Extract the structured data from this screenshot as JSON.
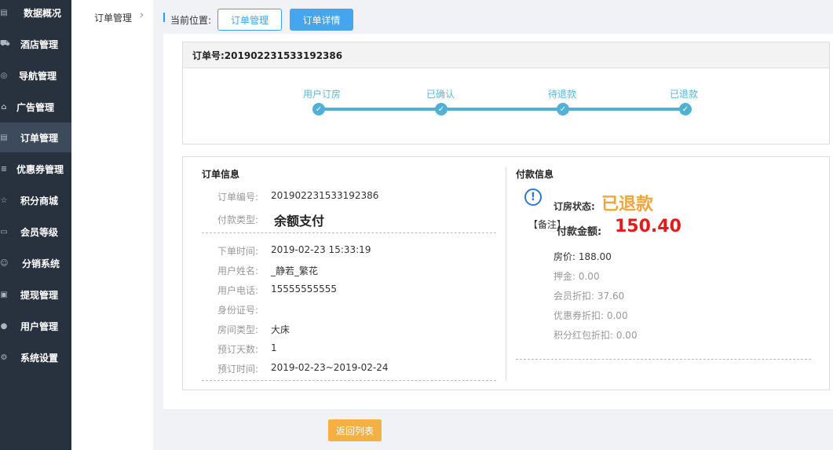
{
  "sidebar": {
    "items": [
      {
        "label": "数据概况",
        "icon": "chart-icon"
      },
      {
        "label": "酒店管理",
        "icon": "cart-icon"
      },
      {
        "label": "导航管理",
        "icon": "compass-icon"
      },
      {
        "label": "广告管理",
        "icon": "gift-icon"
      },
      {
        "label": "订单管理",
        "icon": "list-icon",
        "active": true
      },
      {
        "label": "优惠券管理",
        "icon": "menu-icon"
      },
      {
        "label": "积分商城",
        "icon": "star-icon"
      },
      {
        "label": "会员等级",
        "icon": "card-icon"
      },
      {
        "label": "分销系统",
        "icon": "users-icon"
      },
      {
        "label": "提现管理",
        "icon": "wallet-icon"
      },
      {
        "label": "用户管理",
        "icon": "user-icon"
      },
      {
        "label": "系统设置",
        "icon": "gear-icon"
      }
    ]
  },
  "subnav": {
    "item": "订单管理",
    "chevron": "›"
  },
  "breadcrumb": {
    "label": "当前位置:",
    "tab1": "订单管理",
    "tab2": "订单详情"
  },
  "order_head": {
    "text": "订单号:201902231533192386"
  },
  "steps": [
    "用户订房",
    "已确认",
    "待退款",
    "已退款"
  ],
  "order_info": {
    "title": "订单信息",
    "number_label": "订单编号:",
    "number": "201902231533192386",
    "paytype_label": "付款类型:",
    "paytype": "余额支付",
    "fields": [
      {
        "label": "下单时间:",
        "value": "2019-02-23 15:33:19"
      },
      {
        "label": "用户姓名:",
        "value": "_静若_繁花"
      },
      {
        "label": "用户电话:",
        "value": "15555555555"
      },
      {
        "label": "身份证号:",
        "value": ""
      },
      {
        "label": "房间类型:",
        "value": "大床"
      },
      {
        "label": "预订天数:",
        "value": "1"
      },
      {
        "label": "预订时间:",
        "value": "2019-02-23~2019-02-24"
      }
    ]
  },
  "pay_info": {
    "title": "付款信息",
    "alert_glyph": "!",
    "remark": "【备注】",
    "status_label": "订房状态:",
    "status": "已退款",
    "amount_label": "付款金额:",
    "amount": "150.40",
    "lines": [
      {
        "text": "房价:  188.00",
        "muted": false
      },
      {
        "text": "押金:  0.00",
        "muted": true
      },
      {
        "text": "会员折扣:  37.60",
        "muted": true
      },
      {
        "text": "优惠券折扣:  0.00",
        "muted": true
      },
      {
        "text": "积分红包折扣:  0.00",
        "muted": true
      }
    ]
  },
  "back_button": "返回列表",
  "colors": {
    "accent": "#45a5ee",
    "status": "#f0a63c",
    "amount": "#e31b1b",
    "step": "#4fb1d6",
    "back": "#f4b042"
  }
}
